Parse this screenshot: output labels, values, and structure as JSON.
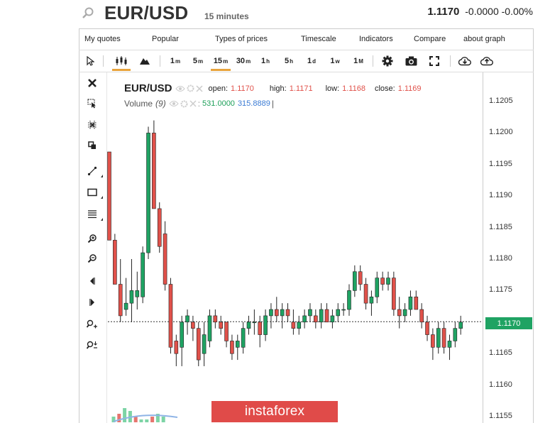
{
  "header": {
    "symbol": "EUR/USD",
    "timeframe": "15 minutes",
    "price": "1.1170",
    "change": "-0.0000",
    "change_pct": "-0.00%"
  },
  "menu": [
    "My quotes",
    "Popular",
    "Types of prices",
    "Timescale",
    "Indicators",
    "Compare",
    "about graph"
  ],
  "intervals": [
    {
      "n": "1",
      "s": "m"
    },
    {
      "n": "5",
      "s": "m"
    },
    {
      "n": "15",
      "s": "m"
    },
    {
      "n": "30",
      "s": "m"
    },
    {
      "n": "1",
      "s": "h"
    },
    {
      "n": "5",
      "s": "h"
    },
    {
      "n": "1",
      "s": "d"
    },
    {
      "n": "1",
      "s": "w"
    },
    {
      "n": "1",
      "s": "M"
    }
  ],
  "legend": {
    "symbol": "EUR/USD",
    "open_label": "open:",
    "open": "1.1170",
    "high_label": "high:",
    "high": "1.1171",
    "low_label": "low:",
    "low": "1.1168",
    "close_label": "close:",
    "close": "1.1169",
    "volume_label": "Volume",
    "volume_period": "(9)",
    "volume_value1": "531.0000",
    "volume_value2": "315.8889"
  },
  "yaxis": {
    "ticks": [
      "1.1205",
      "1.1200",
      "1.1195",
      "1.1190",
      "1.1185",
      "1.1180",
      "1.1175",
      "1.1170",
      "1.1165",
      "1.1160",
      "1.1155"
    ],
    "current_price": "1.1170"
  },
  "colors": {
    "up": "#1fa363",
    "down": "#e0514a",
    "accent": "#e8a33c",
    "brand": "#e04b49"
  },
  "logo": "instaforex",
  "chart_data": {
    "type": "candlestick",
    "ylim": [
      1.1153,
      1.1211
    ],
    "candles": [
      {
        "o": 1.1197,
        "h": 1.1197,
        "l": 1.1183,
        "c": 1.1183
      },
      {
        "o": 1.1183,
        "h": 1.1184,
        "l": 1.1176,
        "c": 1.1176
      },
      {
        "o": 1.1176,
        "h": 1.118,
        "l": 1.117,
        "c": 1.1171
      },
      {
        "o": 1.1172,
        "h": 1.1177,
        "l": 1.1171,
        "c": 1.1173
      },
      {
        "o": 1.1173,
        "h": 1.118,
        "l": 1.117,
        "c": 1.1175
      },
      {
        "o": 1.1174,
        "h": 1.1178,
        "l": 1.1172,
        "c": 1.1175
      },
      {
        "o": 1.1174,
        "h": 1.1182,
        "l": 1.1173,
        "c": 1.1181
      },
      {
        "o": 1.1181,
        "h": 1.1201,
        "l": 1.118,
        "c": 1.12
      },
      {
        "o": 1.12,
        "h": 1.1202,
        "l": 1.1188,
        "c": 1.1188
      },
      {
        "o": 1.1188,
        "h": 1.1189,
        "l": 1.1181,
        "c": 1.1182
      },
      {
        "o": 1.1184,
        "h": 1.1186,
        "l": 1.1175,
        "c": 1.1176
      },
      {
        "o": 1.1176,
        "h": 1.1177,
        "l": 1.1165,
        "c": 1.1166
      },
      {
        "o": 1.1167,
        "h": 1.1168,
        "l": 1.1163,
        "c": 1.1165
      },
      {
        "o": 1.1166,
        "h": 1.1171,
        "l": 1.1163,
        "c": 1.117
      },
      {
        "o": 1.117,
        "h": 1.1172,
        "l": 1.1168,
        "c": 1.1171
      },
      {
        "o": 1.117,
        "h": 1.1171,
        "l": 1.1167,
        "c": 1.1169
      },
      {
        "o": 1.1169,
        "h": 1.117,
        "l": 1.1163,
        "c": 1.1164
      },
      {
        "o": 1.1165,
        "h": 1.117,
        "l": 1.1163,
        "c": 1.1168
      },
      {
        "o": 1.1167,
        "h": 1.1172,
        "l": 1.1166,
        "c": 1.1171
      },
      {
        "o": 1.1171,
        "h": 1.1172,
        "l": 1.1169,
        "c": 1.117
      },
      {
        "o": 1.117,
        "h": 1.1171,
        "l": 1.1168,
        "c": 1.1169
      },
      {
        "o": 1.117,
        "h": 1.117,
        "l": 1.1166,
        "c": 1.1167
      },
      {
        "o": 1.1167,
        "h": 1.1168,
        "l": 1.1164,
        "c": 1.1165
      },
      {
        "o": 1.1166,
        "h": 1.1168,
        "l": 1.1164,
        "c": 1.1167
      },
      {
        "o": 1.1166,
        "h": 1.117,
        "l": 1.1165,
        "c": 1.1169
      },
      {
        "o": 1.1169,
        "h": 1.1171,
        "l": 1.1168,
        "c": 1.117
      },
      {
        "o": 1.117,
        "h": 1.1172,
        "l": 1.1168,
        "c": 1.117
      },
      {
        "o": 1.117,
        "h": 1.1171,
        "l": 1.1166,
        "c": 1.1168
      },
      {
        "o": 1.1168,
        "h": 1.1172,
        "l": 1.1167,
        "c": 1.1171
      },
      {
        "o": 1.1171,
        "h": 1.1173,
        "l": 1.1169,
        "c": 1.1172
      },
      {
        "o": 1.1172,
        "h": 1.1174,
        "l": 1.117,
        "c": 1.1171
      },
      {
        "o": 1.1171,
        "h": 1.1173,
        "l": 1.1169,
        "c": 1.1172
      },
      {
        "o": 1.1172,
        "h": 1.1173,
        "l": 1.117,
        "c": 1.1171
      },
      {
        "o": 1.117,
        "h": 1.1172,
        "l": 1.1168,
        "c": 1.1169
      },
      {
        "o": 1.1169,
        "h": 1.1171,
        "l": 1.1168,
        "c": 1.117
      },
      {
        "o": 1.117,
        "h": 1.1172,
        "l": 1.1169,
        "c": 1.1171
      },
      {
        "o": 1.1171,
        "h": 1.1173,
        "l": 1.117,
        "c": 1.1172
      },
      {
        "o": 1.1171,
        "h": 1.1172,
        "l": 1.1169,
        "c": 1.117
      },
      {
        "o": 1.117,
        "h": 1.1173,
        "l": 1.1169,
        "c": 1.1172
      },
      {
        "o": 1.1172,
        "h": 1.1173,
        "l": 1.117,
        "c": 1.117
      },
      {
        "o": 1.117,
        "h": 1.1172,
        "l": 1.1169,
        "c": 1.1171
      },
      {
        "o": 1.1171,
        "h": 1.1173,
        "l": 1.117,
        "c": 1.1172
      },
      {
        "o": 1.1172,
        "h": 1.1173,
        "l": 1.1171,
        "c": 1.1172
      },
      {
        "o": 1.1172,
        "h": 1.1176,
        "l": 1.1171,
        "c": 1.1175
      },
      {
        "o": 1.1175,
        "h": 1.1179,
        "l": 1.1174,
        "c": 1.1178
      },
      {
        "o": 1.1178,
        "h": 1.1179,
        "l": 1.1175,
        "c": 1.1176
      },
      {
        "o": 1.1176,
        "h": 1.1177,
        "l": 1.1172,
        "c": 1.1173
      },
      {
        "o": 1.1173,
        "h": 1.1175,
        "l": 1.1171,
        "c": 1.1174
      },
      {
        "o": 1.1174,
        "h": 1.1178,
        "l": 1.1173,
        "c": 1.1177
      },
      {
        "o": 1.1177,
        "h": 1.1178,
        "l": 1.1175,
        "c": 1.1176
      },
      {
        "o": 1.1176,
        "h": 1.1178,
        "l": 1.1175,
        "c": 1.1177
      },
      {
        "o": 1.1177,
        "h": 1.1178,
        "l": 1.1171,
        "c": 1.1172
      },
      {
        "o": 1.1172,
        "h": 1.1174,
        "l": 1.1169,
        "c": 1.1171
      },
      {
        "o": 1.1171,
        "h": 1.1173,
        "l": 1.117,
        "c": 1.1172
      },
      {
        "o": 1.1172,
        "h": 1.1175,
        "l": 1.1171,
        "c": 1.1174
      },
      {
        "o": 1.1174,
        "h": 1.1175,
        "l": 1.1172,
        "c": 1.1172
      },
      {
        "o": 1.1172,
        "h": 1.1173,
        "l": 1.1169,
        "c": 1.117
      },
      {
        "o": 1.117,
        "h": 1.1171,
        "l": 1.1167,
        "c": 1.1168
      },
      {
        "o": 1.1168,
        "h": 1.1169,
        "l": 1.1164,
        "c": 1.1166
      },
      {
        "o": 1.1166,
        "h": 1.117,
        "l": 1.1165,
        "c": 1.1169
      },
      {
        "o": 1.1169,
        "h": 1.117,
        "l": 1.1165,
        "c": 1.1166
      },
      {
        "o": 1.1166,
        "h": 1.1168,
        "l": 1.1164,
        "c": 1.1167
      },
      {
        "o": 1.1167,
        "h": 1.117,
        "l": 1.1166,
        "c": 1.1169
      },
      {
        "o": 1.1169,
        "h": 1.1171,
        "l": 1.1168,
        "c": 1.117
      }
    ],
    "volume": [
      2,
      3,
      5,
      4,
      2,
      1,
      1,
      2,
      3,
      2
    ]
  }
}
